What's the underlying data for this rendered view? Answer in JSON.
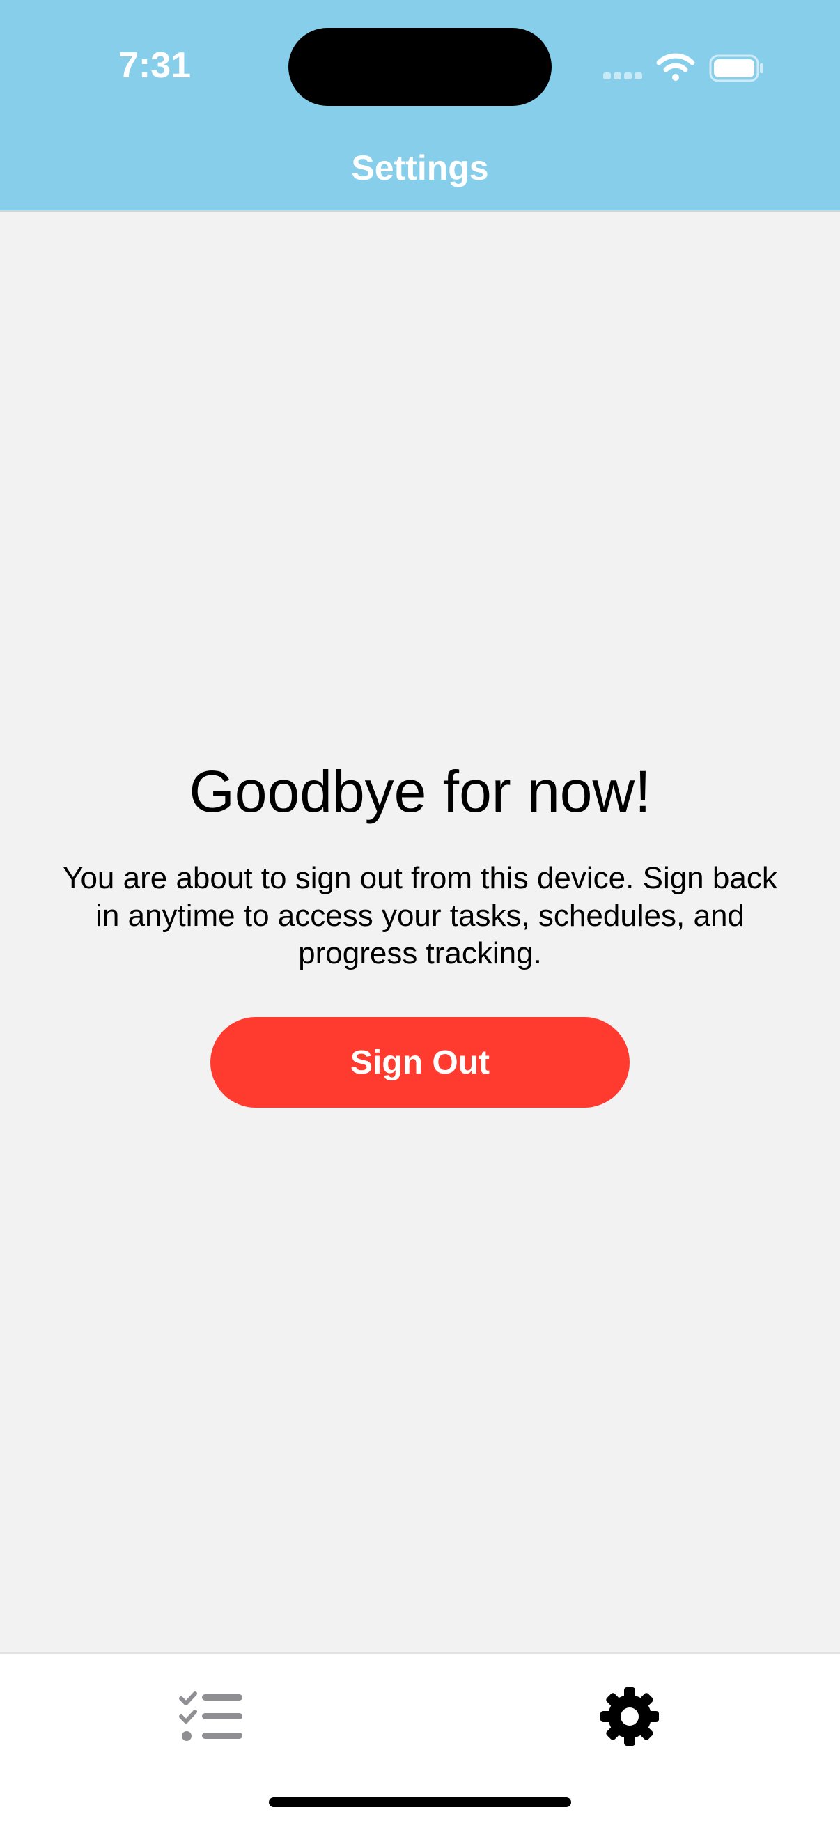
{
  "status_bar": {
    "time": "7:31"
  },
  "nav": {
    "title": "Settings"
  },
  "main": {
    "heading": "Goodbye for now!",
    "message": "You are about to sign out from this device. Sign back in anytime to access your tasks, schedules, and progress tracking.",
    "sign_out_label": "Sign Out"
  },
  "tab_bar": {
    "items": [
      {
        "icon": "checklist-icon",
        "selected": false
      },
      {
        "icon": "gear-icon",
        "selected": true
      }
    ]
  },
  "colors": {
    "nav_background": "#87ceeb",
    "page_background": "#f2f2f2",
    "sign_out_button": "#ff3b30",
    "tab_inactive": "#8e8e93",
    "tab_active": "#000000"
  }
}
